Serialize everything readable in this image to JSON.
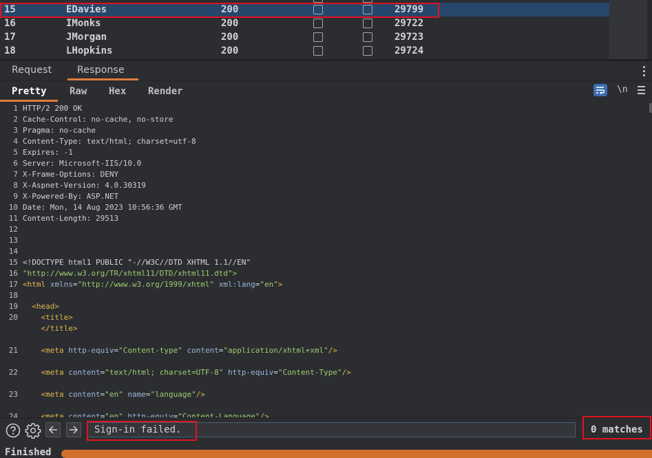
{
  "results": {
    "rows": [
      {
        "num": "15",
        "name": "EDavies",
        "status": "200",
        "length": "29799",
        "selected": true
      },
      {
        "num": "16",
        "name": "IMonks",
        "status": "200",
        "length": "29722",
        "selected": false
      },
      {
        "num": "17",
        "name": "JMorgan",
        "status": "200",
        "length": "29723",
        "selected": false
      },
      {
        "num": "18",
        "name": "LHopkins",
        "status": "200",
        "length": "29724",
        "selected": false
      }
    ]
  },
  "tabs": {
    "request": "Request",
    "response": "Response",
    "active": "Response"
  },
  "views": {
    "pretty": "Pretty",
    "raw": "Raw",
    "hex": "Hex",
    "render": "Render",
    "active": "Pretty",
    "newline_label": "\\n"
  },
  "icons": {
    "wrap": "wrap-lines-icon",
    "newline": "newline-icon",
    "menu": "menu-icon",
    "help": "help-icon",
    "settings": "gear-icon",
    "prev": "arrow-left-icon",
    "next": "arrow-right-icon",
    "more": "kebab-menu-icon"
  },
  "editor": {
    "lines": [
      {
        "n": "1",
        "k": "HTTP/2 200 OK",
        "v": ""
      },
      {
        "n": "2",
        "k": "Cache-Control",
        "v": "no-cache, no-store"
      },
      {
        "n": "3",
        "k": "Pragma",
        "v": "no-cache"
      },
      {
        "n": "4",
        "k": "Content-Type",
        "v": "text/html; charset=utf-8"
      },
      {
        "n": "5",
        "k": "Expires",
        "v": "-1"
      },
      {
        "n": "6",
        "k": "Server",
        "v": "Microsoft-IIS/10.0"
      },
      {
        "n": "7",
        "k": "X-Frame-Options",
        "v": "DENY"
      },
      {
        "n": "8",
        "k": "X-Aspnet-Version",
        "v": "4.0.30319"
      },
      {
        "n": "9",
        "k": "X-Powered-By",
        "v": "ASP.NET"
      },
      {
        "n": "10",
        "k": "Date",
        "v": "Mon, 14 Aug 2023 10:56:36 GMT"
      },
      {
        "n": "11",
        "k": "Content-Length",
        "v": "29513"
      },
      {
        "n": "12"
      },
      {
        "n": "13"
      },
      {
        "n": "14"
      },
      {
        "n": "15",
        "t": "<!DOCTYPE html1 PUBLIC \"-//W3C//DTD XHTML 1.1//EN\""
      },
      {
        "n": "16",
        "t": "\"http://www.w3.org/TR/xhtml11/DTD/xhtml11.dtd\">"
      },
      {
        "n": "17",
        "tag": "html",
        "a1": "xmlns",
        "s1": "\"http://www.w3.org/1999/xhtml\"",
        "a2": "xml:lang",
        "s2": "\"en\"",
        "end": ">"
      },
      {
        "n": "18"
      },
      {
        "n": "19",
        "indent": "  ",
        "tag": "head",
        "end": ">"
      },
      {
        "n": "20",
        "indent": "    ",
        "tag": "title",
        "end": ">"
      },
      {
        "n": "",
        "indent": "    ",
        "closetag": "title"
      },
      {
        "n": "21",
        "indent": "    ",
        "tag": "meta",
        "a1": "http-equiv",
        "s1": "\"Content-type\"",
        "a2": "content",
        "s2": "\"application/xhtml+xml\"",
        "end": "/>"
      },
      {
        "n": "22",
        "indent": "    ",
        "tag": "meta",
        "a1": "content",
        "s1": "\"text/html; charset=UTF-8\"",
        "a2": "http-equiv",
        "s2": "\"Content-Type\"",
        "end": "/>"
      },
      {
        "n": "23",
        "indent": "    ",
        "tag": "meta",
        "a1": "content",
        "s1": "\"en\"",
        "a2": "name",
        "s2": "\"language\"",
        "end": "/>"
      },
      {
        "n": "24",
        "indent": "    ",
        "tag": "meta",
        "a1": "content",
        "s1": "\"en\"",
        "a2": "http-equiv",
        "s2": "\"Content-Language\"",
        "end": "/>"
      }
    ]
  },
  "search": {
    "value": "Sign-in failed.",
    "matches": "0 matches"
  },
  "status": {
    "text": "Finished",
    "progress_pct": 100
  },
  "colors": {
    "selected_row": "#27466c",
    "accent_orange": "#e07b3f",
    "highlight_box": "#e0141c",
    "wrap_active": "#3c6fb0"
  }
}
